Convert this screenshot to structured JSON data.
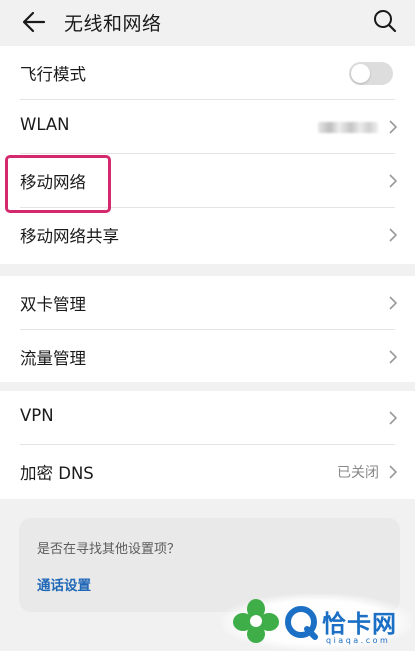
{
  "header": {
    "title": "无线和网络",
    "back_icon": "arrow-left-icon",
    "search_icon": "search-icon"
  },
  "groups": [
    {
      "items": [
        {
          "label": "飞行模式",
          "control": "toggle",
          "toggle_on": false
        },
        {
          "label": "WLAN",
          "value_obscured": true
        },
        {
          "label": "移动网络",
          "highlighted": true
        },
        {
          "label": "移动网络共享"
        }
      ]
    },
    {
      "items": [
        {
          "label": "双卡管理"
        },
        {
          "label": "流量管理"
        }
      ]
    },
    {
      "items": [
        {
          "label": "VPN"
        },
        {
          "label": "加密 DNS",
          "value": "已关闭"
        }
      ]
    }
  ],
  "suggestion": {
    "question": "是否在寻找其他设置项？",
    "link": "通话设置"
  },
  "watermark": {
    "name": "恰卡网",
    "url": "qiaqa.com"
  },
  "colors": {
    "highlight_border": "#d5296e",
    "link": "#1f67b7",
    "background": "#f1f1f1"
  }
}
